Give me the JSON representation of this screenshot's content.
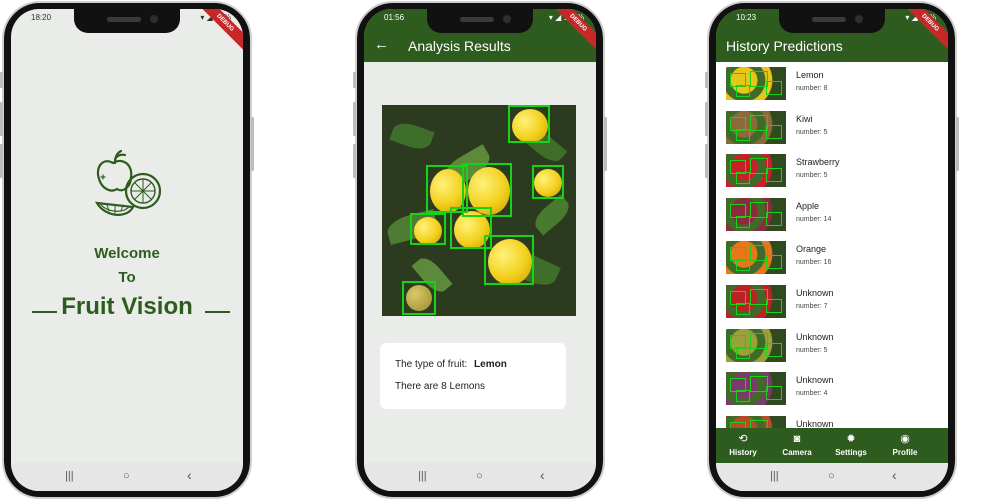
{
  "phone1": {
    "status_time": "18:20",
    "status_right": "▾ ◢ 91%",
    "debug_banner": "DEBUG",
    "welcome_line1": "Welcome",
    "welcome_line2": "To",
    "app_name": "Fruit Vision",
    "logo_icon": "fruit-illustration-icon"
  },
  "phone2": {
    "status_time": "01:56",
    "status_right": "▾ ◢ 100%",
    "debug_banner": "DEBUG",
    "back_icon": "←",
    "title": "Analysis Results",
    "result_label": "The type of fruit:",
    "result_value": "Lemon",
    "result_count": "There are 8 Lemons"
  },
  "phone3": {
    "status_time": "10:23",
    "status_right": "▾ ◢ 74%",
    "debug_banner": "DEBUG",
    "title": "History Predictions",
    "items": [
      {
        "name": "Lemon",
        "count": "number: 8",
        "color": "#e8c51a"
      },
      {
        "name": "Kiwi",
        "count": "number: 5",
        "color": "#8b6a3a"
      },
      {
        "name": "Strawberry",
        "count": "number: 5",
        "color": "#c8202a"
      },
      {
        "name": "Apple",
        "count": "number: 14",
        "color": "#8c2a3e"
      },
      {
        "name": "Orange",
        "count": "number: 16",
        "color": "#e6781a"
      },
      {
        "name": "Unknown",
        "count": "number: 7",
        "color": "#b82424"
      },
      {
        "name": "Unknown",
        "count": "number: 5",
        "color": "#9aa03a"
      },
      {
        "name": "Unknown",
        "count": "number: 4",
        "color": "#7a3a6a"
      },
      {
        "name": "Unknown",
        "count": "",
        "color": "#b84a2a"
      }
    ],
    "nav": [
      {
        "label": "History",
        "icon": "⟲"
      },
      {
        "label": "Camera",
        "icon": "◙"
      },
      {
        "label": "Settings",
        "icon": "✹"
      },
      {
        "label": "Profile",
        "icon": "◉"
      }
    ]
  },
  "nav_buttons": {
    "recent": "|||",
    "home": "○",
    "back": "‹"
  }
}
